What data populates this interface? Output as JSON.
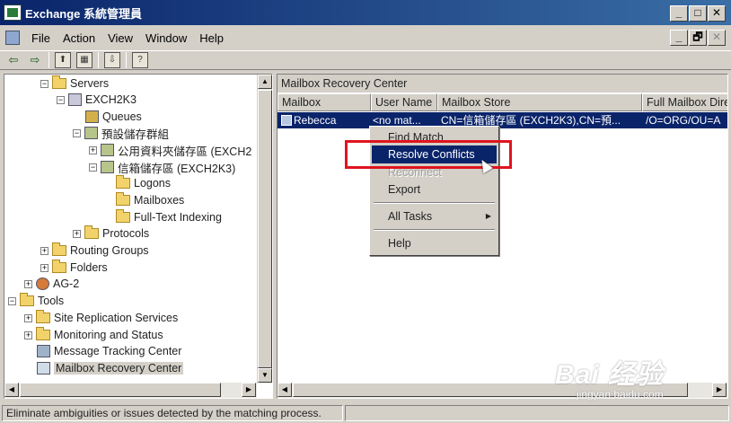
{
  "window": {
    "title": "Exchange 系統管理員",
    "minimize_glyph": "_",
    "maximize_glyph": "□",
    "close_glyph": "✕"
  },
  "menubar": {
    "items": [
      "File",
      "Action",
      "View",
      "Window",
      "Help"
    ],
    "mdi_min_glyph": "_",
    "mdi_restore_glyph": "🗗",
    "mdi_close_glyph": "✕"
  },
  "toolbar": {
    "back_glyph": "⇦",
    "forward_glyph": "⇨",
    "up_glyph": "⬆",
    "tree_glyph": "▦",
    "export_glyph": "⇩",
    "help_glyph": "?"
  },
  "tree": {
    "items": [
      {
        "label": "Servers",
        "expander": "−"
      },
      {
        "label": "EXCH2K3",
        "expander": "−"
      },
      {
        "label": "Queues",
        "expander": ""
      },
      {
        "label": "預設儲存群組",
        "expander": "−"
      },
      {
        "label": "公用資料夾儲存區 (EXCH2",
        "expander": "+"
      },
      {
        "label": "信箱儲存區 (EXCH2K3)",
        "expander": "−"
      },
      {
        "label": "Logons",
        "expander": ""
      },
      {
        "label": "Mailboxes",
        "expander": ""
      },
      {
        "label": "Full-Text Indexing",
        "expander": ""
      },
      {
        "label": "Protocols",
        "expander": "+"
      },
      {
        "label": "Routing Groups",
        "expander": "+"
      },
      {
        "label": "Folders",
        "expander": "+"
      },
      {
        "label": "AG-2",
        "expander": "+"
      },
      {
        "label": "Tools",
        "expander": "−"
      },
      {
        "label": "Site Replication Services",
        "expander": "+"
      },
      {
        "label": "Monitoring and Status",
        "expander": "+"
      },
      {
        "label": "Message Tracking Center",
        "expander": ""
      },
      {
        "label": "Mailbox Recovery Center",
        "expander": ""
      }
    ]
  },
  "right_pane": {
    "title": "Mailbox Recovery Center",
    "columns": [
      "Mailbox",
      "User Name",
      "Mailbox Store",
      "Full Mailbox Dire"
    ],
    "rows": [
      {
        "mailbox": "Rebecca",
        "user_name": "<no mat...",
        "store": "CN=信箱儲存區 (EXCH2K3),CN=預...",
        "full_dir": "/O=ORG/OU=A"
      }
    ]
  },
  "context_menu": {
    "items": [
      {
        "label": "Find Match",
        "state": "normal"
      },
      {
        "label": "Resolve Conflicts",
        "state": "highlight"
      },
      {
        "label": "Reconnect",
        "state": "disabled"
      },
      {
        "label": "Export",
        "state": "normal"
      },
      {
        "label": "All Tasks",
        "state": "submenu"
      },
      {
        "label": "Help",
        "state": "normal"
      }
    ],
    "submenu_glyph": "▶"
  },
  "scroll": {
    "up": "▲",
    "down": "▼",
    "left": "◀",
    "right": "▶"
  },
  "status": {
    "text": "Eliminate ambiguities or issues detected by the matching process."
  },
  "watermark": {
    "main": "Bai 经验",
    "sub": "jingyan.baidu.com"
  },
  "colors": {
    "selection": "#0a246a",
    "highlight_box": "#e0141e"
  }
}
